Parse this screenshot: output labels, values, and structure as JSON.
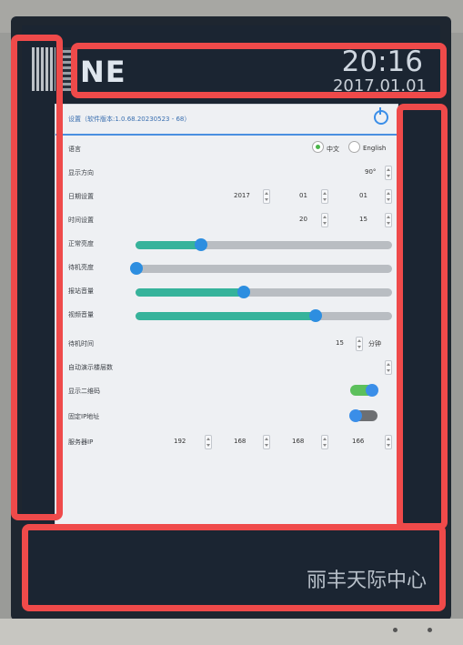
{
  "brand": {
    "name": "NE"
  },
  "clock": {
    "time": "20:16",
    "date": "2017.01.01"
  },
  "footer": {
    "location": "丽丰天际中心"
  },
  "settings": {
    "title": "设置（软件版本:1.0.68.20230523 - 68）",
    "language": {
      "label": "语言",
      "options": [
        "中文",
        "English"
      ],
      "selected": "中文"
    },
    "orientation": {
      "label": "显示方向",
      "value": "90°"
    },
    "date": {
      "label": "日期设置",
      "year": "2017",
      "month": "01",
      "day": "01"
    },
    "time": {
      "label": "时间设置",
      "hour": "20",
      "minute": "15"
    },
    "brightness_normal": {
      "label": "正常亮度",
      "percent": 25
    },
    "brightness_standby": {
      "label": "待机亮度",
      "percent": 0
    },
    "volume_announce": {
      "label": "报站音量",
      "percent": 42
    },
    "volume_video": {
      "label": "视频音量",
      "percent": 70
    },
    "standby_time": {
      "label": "待机时间",
      "value": "15",
      "unit": "分钟"
    },
    "auto_demo": {
      "label": "自动演示楼层数"
    },
    "show_qr": {
      "label": "显示二维码",
      "on": true
    },
    "fixed_ip": {
      "label": "固定IP地址",
      "on": false
    },
    "server_ip": {
      "label": "服务器IP",
      "octets": [
        "192",
        "168",
        "168",
        "166"
      ]
    }
  },
  "colors": {
    "accent": "#3a8ee8",
    "slider_fill": "#36b39b",
    "highlight": "#ef4a4a"
  }
}
